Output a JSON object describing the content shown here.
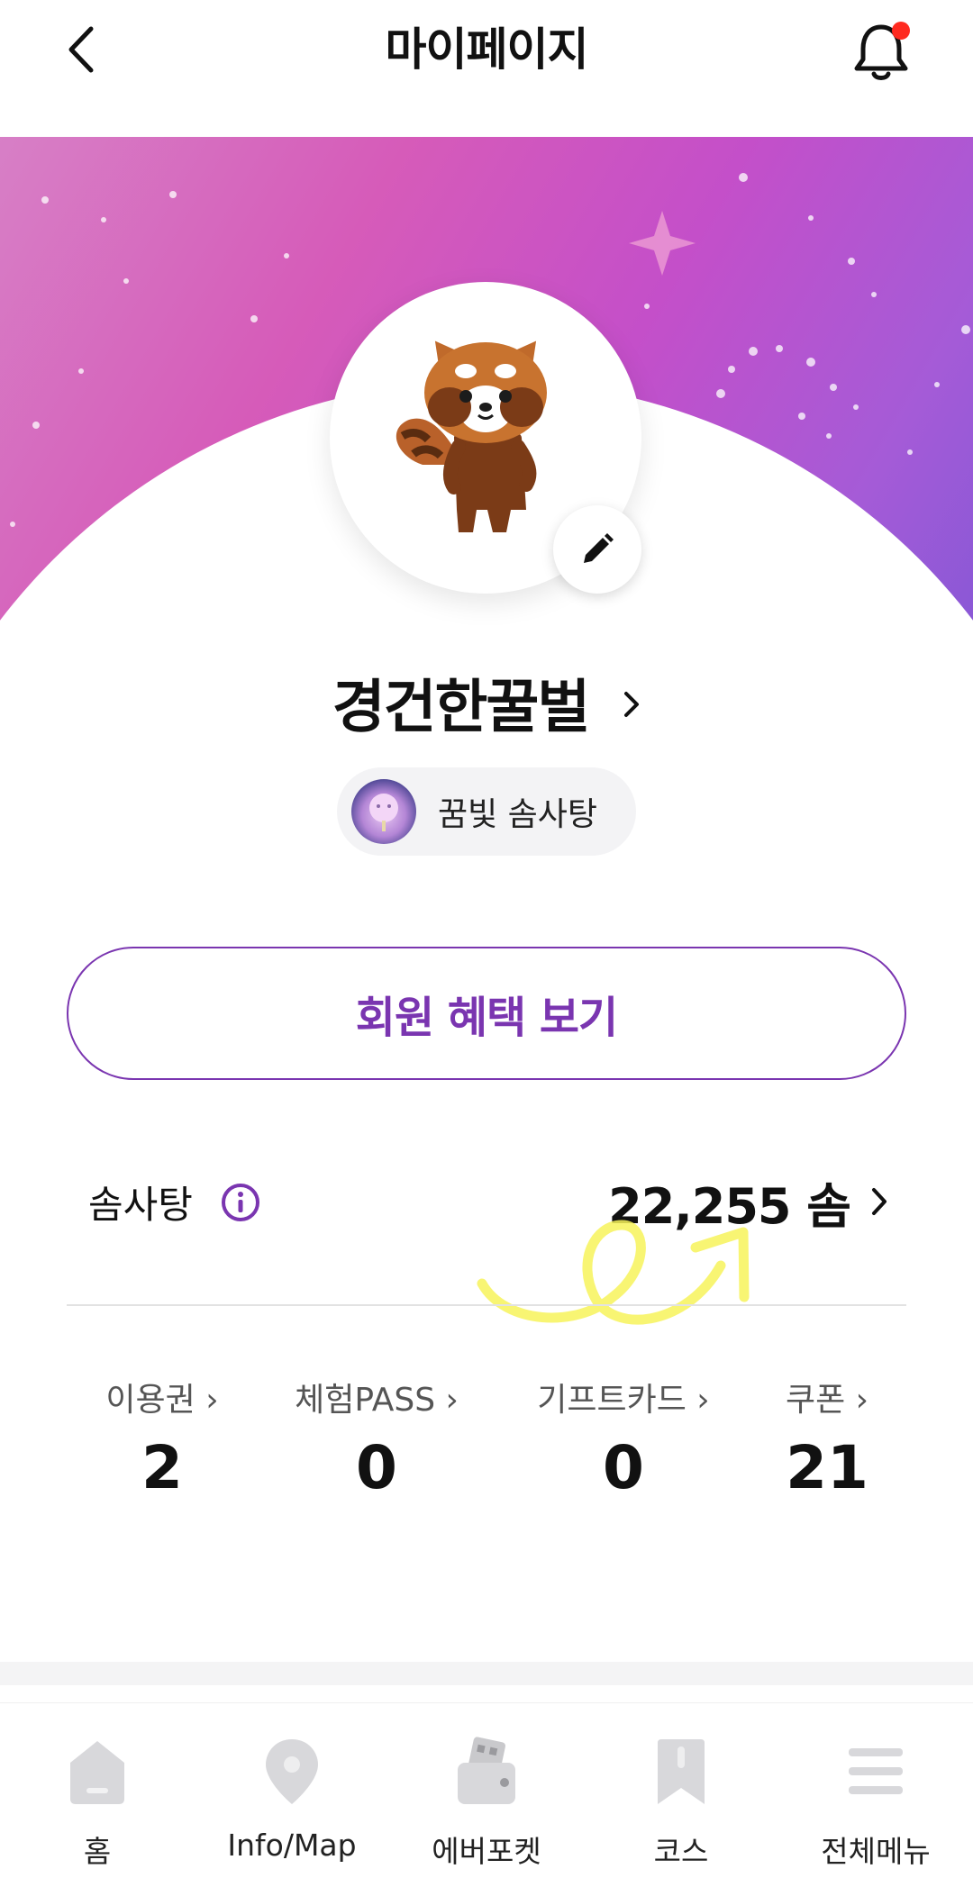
{
  "header": {
    "title": "마이페이지",
    "back_icon": "chevron-left-icon",
    "notification_icon": "bell-icon",
    "notification_dot_color": "#ff2a1f"
  },
  "profile": {
    "avatar": "red-panda-avatar",
    "nickname": "경건한꿀벌",
    "badge_label": "꿈빛 솜사탕"
  },
  "benefit_button": {
    "label": "회원 혜택 보기",
    "color": "#7a35b0"
  },
  "points": {
    "label": "솜사탕",
    "value": "22,255 솜"
  },
  "stats": [
    {
      "label": "이용권 ›",
      "value": "2"
    },
    {
      "label": "체험PASS ›",
      "value": "0"
    },
    {
      "label": "기프트카드 ›",
      "value": "0"
    },
    {
      "label": "쿠폰 ›",
      "value": "21"
    }
  ],
  "bottom_nav": [
    {
      "label": "홈",
      "icon": "home-icon"
    },
    {
      "label": "Info/Map",
      "icon": "map-pin-icon"
    },
    {
      "label": "에버포켓",
      "icon": "wallet-icon"
    },
    {
      "label": "코스",
      "icon": "bookmark-icon"
    },
    {
      "label": "전체메뉴",
      "icon": "menu-icon"
    }
  ]
}
